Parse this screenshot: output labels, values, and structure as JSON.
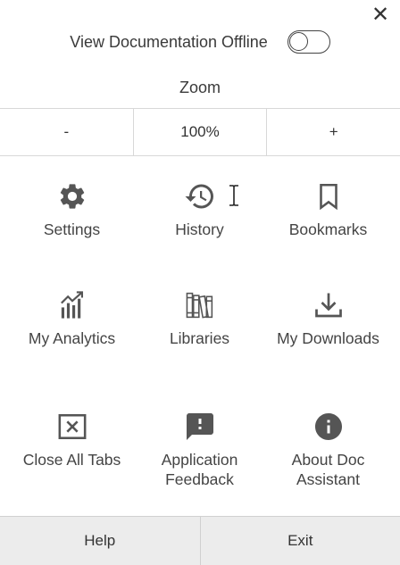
{
  "close_label": "✕",
  "offline": {
    "label": "View Documentation Offline",
    "enabled": false
  },
  "zoom": {
    "label": "Zoom",
    "decrease": "-",
    "value": "100%",
    "increase": "+"
  },
  "tiles": [
    {
      "label": "Settings",
      "icon": "gear-icon"
    },
    {
      "label": "History",
      "icon": "history-icon"
    },
    {
      "label": "Bookmarks",
      "icon": "bookmark-icon"
    },
    {
      "label": "My Analytics",
      "icon": "analytics-icon"
    },
    {
      "label": "Libraries",
      "icon": "books-icon"
    },
    {
      "label": "My Downloads",
      "icon": "download-icon"
    },
    {
      "label": "Close All Tabs",
      "icon": "close-box-icon"
    },
    {
      "label": "Application Feedback",
      "icon": "feedback-icon"
    },
    {
      "label": "About Doc Assistant",
      "icon": "info-icon"
    }
  ],
  "footer": {
    "help": "Help",
    "exit": "Exit"
  },
  "colors": {
    "icon": "#555555",
    "footer_bg": "#ececec",
    "border": "#d8d8d8"
  }
}
